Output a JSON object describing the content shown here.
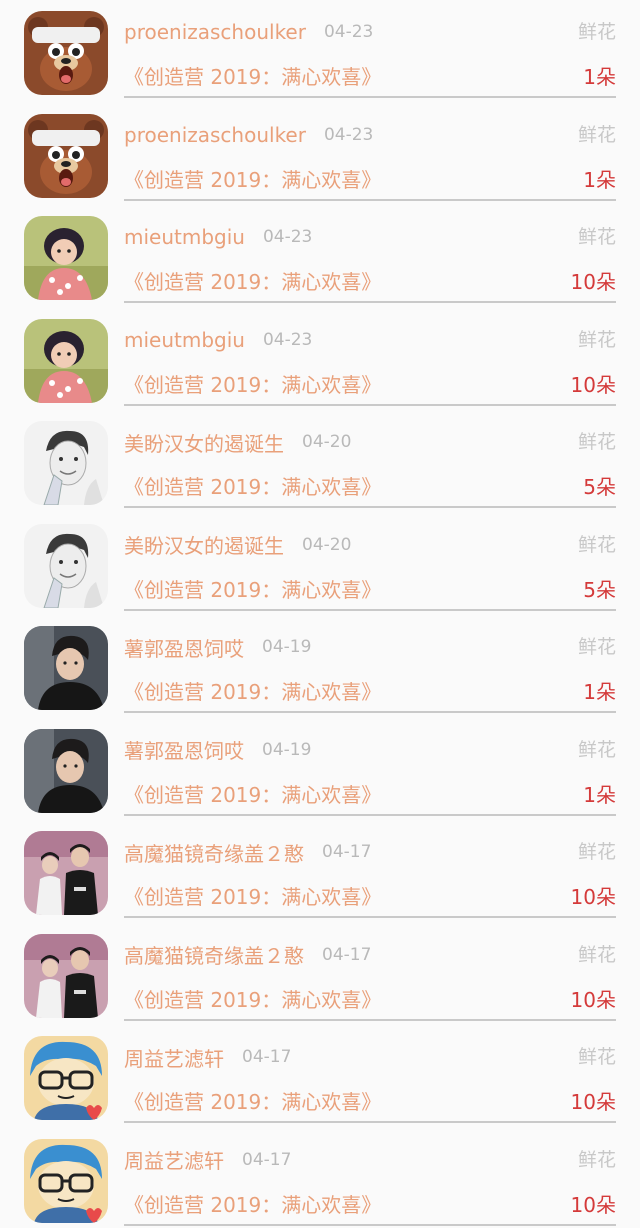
{
  "gift_records": [
    {
      "username": "proenizaschoulker",
      "date": "04-23",
      "category": "鲜花",
      "program": "《创造营 2019：满心欢喜》",
      "amount": "1朵",
      "avatar": "bear-cartoon"
    },
    {
      "username": "proenizaschoulker",
      "date": "04-23",
      "category": "鲜花",
      "program": "《创造营 2019：满心欢喜》",
      "amount": "1朵",
      "avatar": "bear-cartoon"
    },
    {
      "username": "mieutmbgiu",
      "date": "04-23",
      "category": "鲜花",
      "program": "《创造营 2019：满心欢喜》",
      "amount": "10朵",
      "avatar": "child-photo"
    },
    {
      "username": "mieutmbgiu",
      "date": "04-23",
      "category": "鲜花",
      "program": "《创造营 2019：满心欢喜》",
      "amount": "10朵",
      "avatar": "child-photo"
    },
    {
      "username": "美盼汉女的遏诞生",
      "date": "04-20",
      "category": "鲜花",
      "program": "《创造营 2019：满心欢喜》",
      "amount": "5朵",
      "avatar": "man-sketch"
    },
    {
      "username": "美盼汉女的遏诞生",
      "date": "04-20",
      "category": "鲜花",
      "program": "《创造营 2019：满心欢喜》",
      "amount": "5朵",
      "avatar": "man-sketch"
    },
    {
      "username": "薯郭盈恩饲哎",
      "date": "04-19",
      "category": "鲜花",
      "program": "《创造营 2019：满心欢喜》",
      "amount": "1朵",
      "avatar": "man-dark-photo"
    },
    {
      "username": "薯郭盈恩饲哎",
      "date": "04-19",
      "category": "鲜花",
      "program": "《创造营 2019：满心欢喜》",
      "amount": "1朵",
      "avatar": "man-dark-photo"
    },
    {
      "username": "高魔猫镜奇缘盖２憨",
      "date": "04-17",
      "category": "鲜花",
      "program": "《创造营 2019：满心欢喜》",
      "amount": "10朵",
      "avatar": "couple-photo"
    },
    {
      "username": "高魔猫镜奇缘盖２憨",
      "date": "04-17",
      "category": "鲜花",
      "program": "《创造营 2019：满心欢喜》",
      "amount": "10朵",
      "avatar": "couple-photo"
    },
    {
      "username": "周益艺滤轩",
      "date": "04-17",
      "category": "鲜花",
      "program": "《创造营 2019：满心欢喜》",
      "amount": "10朵",
      "avatar": "glasses-cartoon"
    },
    {
      "username": "周益艺滤轩",
      "date": "04-17",
      "category": "鲜花",
      "program": "《创造营 2019：满心欢喜》",
      "amount": "10朵",
      "avatar": "glasses-cartoon"
    }
  ],
  "colors": {
    "username": "#e9a07a",
    "date": "#b9b9b9",
    "category": "#c8c8c8",
    "amount": "#d43a3a",
    "divider": "#c9c9c9"
  }
}
